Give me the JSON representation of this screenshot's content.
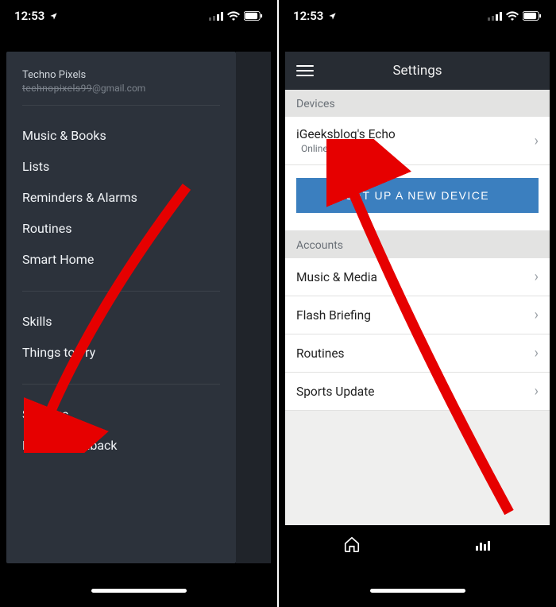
{
  "statusbar": {
    "time": "12:53"
  },
  "left": {
    "profile": {
      "name": "Techno Pixels",
      "email_redacted": "technopixels99",
      "email_domain": "@gmail.com"
    },
    "group1": [
      "Music & Books",
      "Lists",
      "Reminders & Alarms",
      "Routines",
      "Smart Home"
    ],
    "group2": [
      "Skills",
      "Things to Try"
    ],
    "group3": [
      "Settings",
      "Help & Feedback"
    ]
  },
  "right": {
    "header_title": "Settings",
    "devices_label": "Devices",
    "echo_name": "iGeeksblog's Echo",
    "echo_status": "Online",
    "setup_label": "SET UP A NEW DEVICE",
    "accounts_label": "Accounts",
    "rows": [
      "Music & Media",
      "Flash Briefing",
      "Routines",
      "Sports Update"
    ]
  }
}
